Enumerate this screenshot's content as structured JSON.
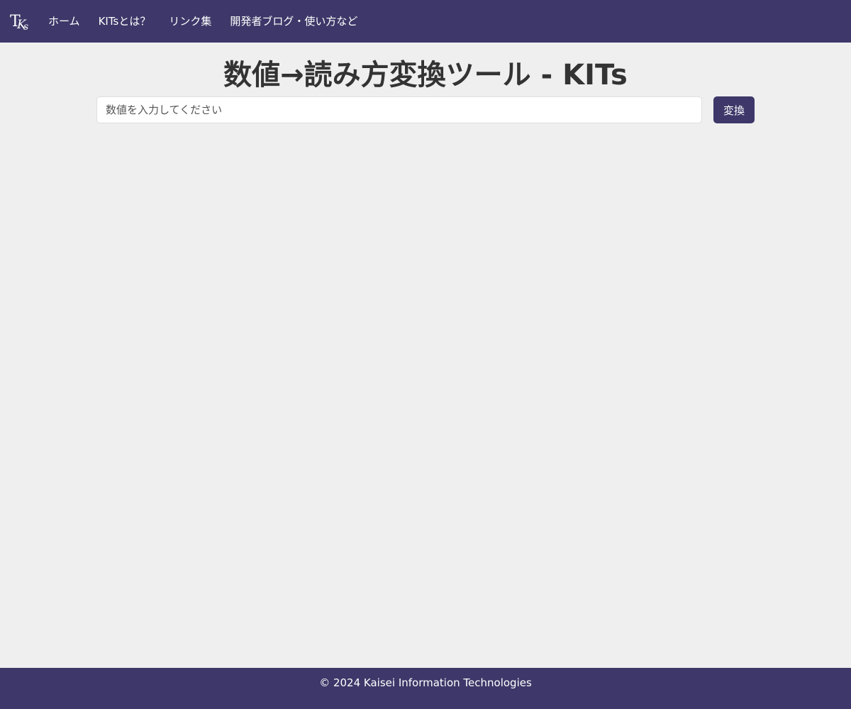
{
  "navbar": {
    "logo_icon": "kits-logo-icon",
    "background_color": "#3d3869",
    "links": [
      {
        "label": "ホーム"
      },
      {
        "label": "KITsとは？"
      },
      {
        "label": "リンク集"
      },
      {
        "label": "開発者ブログ・使い方など"
      }
    ]
  },
  "main": {
    "title": "数値→読み方変換ツール - KITs",
    "input_placeholder": "数値を入力してください",
    "input_value": "",
    "convert_label": "変換"
  },
  "footer": {
    "copyright": "© 2024 Kaisei Information Technologies"
  },
  "colors": {
    "accent": "#3d3869",
    "page_background": "#efefef",
    "title_text": "#333333"
  }
}
